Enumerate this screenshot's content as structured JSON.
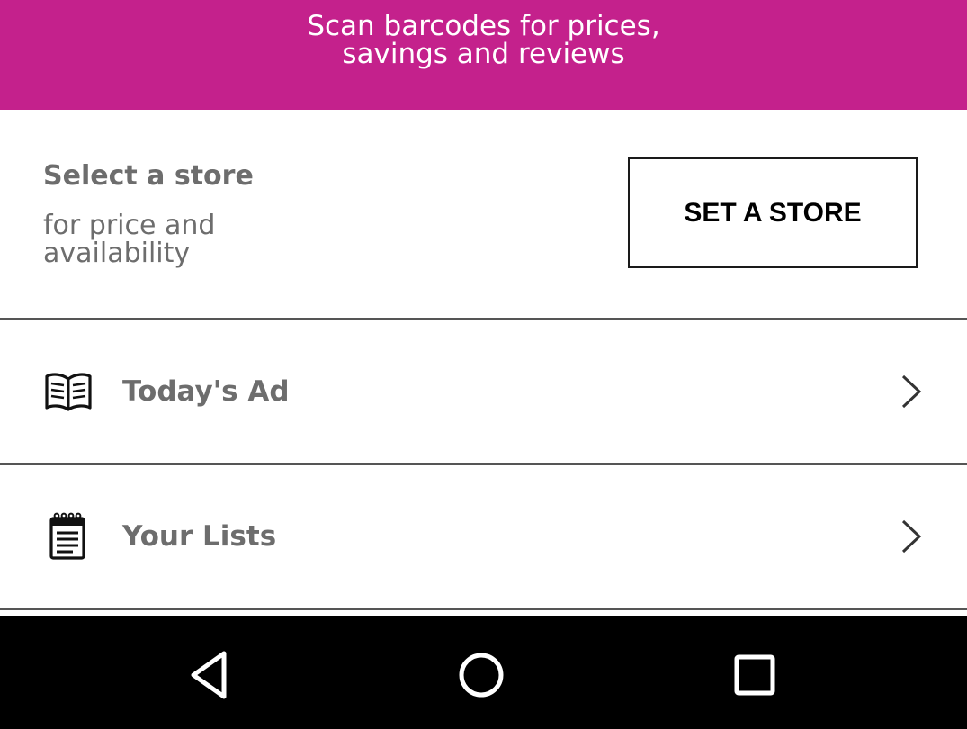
{
  "colors": {
    "banner_bg": "#c4218c",
    "text_gray": "#6d6d6d",
    "divider": "#555555",
    "navbar_bg": "#000000"
  },
  "banner": {
    "line1": "Scan barcodes for prices,",
    "line2": "savings and reviews"
  },
  "store": {
    "title": "Select a store",
    "subtitle_line1": "for price and",
    "subtitle_line2": "availability",
    "button_label": "SET A STORE"
  },
  "menu": {
    "items": [
      {
        "label": "Today's Ad",
        "icon": "open-book-icon"
      },
      {
        "label": "Your Lists",
        "icon": "notepad-icon"
      }
    ]
  },
  "navbar": {
    "buttons": [
      "back-icon",
      "home-icon",
      "recents-icon"
    ]
  }
}
